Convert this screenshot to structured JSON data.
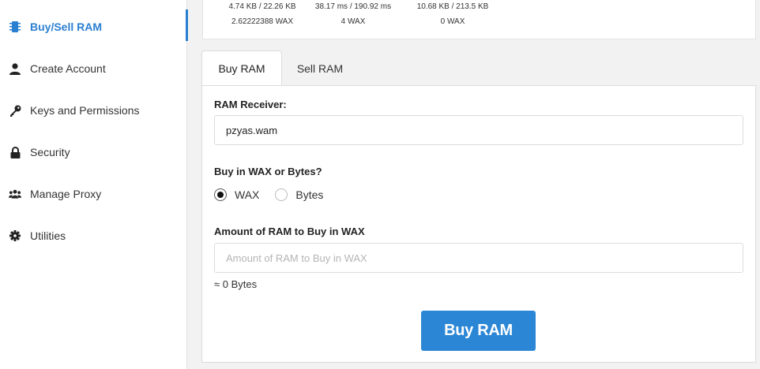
{
  "sidebar": {
    "items": [
      {
        "label": "Buy/Sell RAM",
        "icon": "chip-icon",
        "active": true
      },
      {
        "label": "Create Account",
        "icon": "user-icon"
      },
      {
        "label": "Keys and Permissions",
        "icon": "key-icon"
      },
      {
        "label": "Security",
        "icon": "lock-icon"
      },
      {
        "label": "Manage Proxy",
        "icon": "users-icon"
      },
      {
        "label": "Utilities",
        "icon": "gear-icon"
      }
    ]
  },
  "resources": {
    "ram_usage": "4.74 KB / 22.26 KB",
    "ram_value": "2.62222388 WAX",
    "cpu_usage": "38.17 ms / 190.92 ms",
    "cpu_value": "4 WAX",
    "net_usage": "10.68 KB / 213.5 KB",
    "net_value": "0 WAX"
  },
  "tabs": [
    {
      "label": "Buy RAM",
      "active": true
    },
    {
      "label": "Sell RAM",
      "active": false
    }
  ],
  "form": {
    "receiver_label": "RAM Receiver:",
    "receiver_value": "pzyas.wam",
    "unit_label": "Buy in WAX or Bytes?",
    "unit_options": [
      {
        "label": "WAX",
        "checked": true
      },
      {
        "label": "Bytes",
        "checked": false
      }
    ],
    "amount_label": "Amount of RAM to Buy in WAX",
    "amount_placeholder": "Amount of RAM to Buy in WAX",
    "amount_value": "",
    "approx_bytes": "≈ 0 Bytes",
    "submit_label": "Buy RAM"
  },
  "colors": {
    "accent": "#2b7fd1",
    "button": "#2b87d6"
  }
}
